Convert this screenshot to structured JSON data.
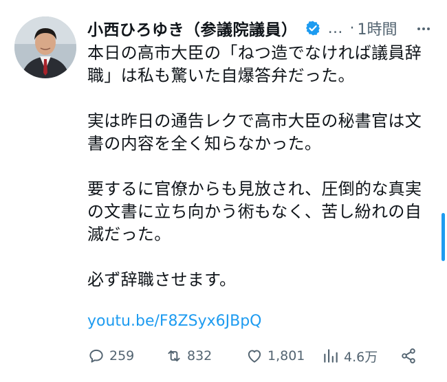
{
  "author": {
    "name": "小西ひろゆき（参議院議員）",
    "handle": "…",
    "separator": "·",
    "time": "1時間"
  },
  "tweet": {
    "paragraphs": [
      "本日の高市大臣の「ねつ造でなければ議員辞職」は私も驚いた自爆答弁だった。",
      "実は昨日の通告レクで高市大臣の秘書官は文書の内容を全く知らなかった。",
      "要するに官僚からも見放され、圧倒的な真実の文書に立ち向かう術もなく、苦し紛れの自滅だった。",
      "必ず辞職させます。"
    ],
    "link": "youtu.be/F8ZSyx6JBpQ"
  },
  "metrics": {
    "replies": "259",
    "retweets": "832",
    "likes": "1,801",
    "views": "4.6万"
  },
  "icons": {
    "verified": "verified-badge-icon",
    "more": "more-icon",
    "reply": "reply-icon",
    "retweet": "retweet-icon",
    "like": "heart-icon",
    "views": "views-icon",
    "share": "share-icon"
  },
  "colors": {
    "accent": "#1d9bf0",
    "muted": "#536471",
    "text": "#0f1419"
  }
}
